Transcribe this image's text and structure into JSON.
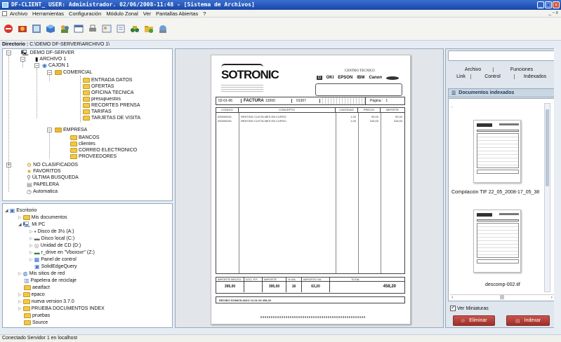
{
  "window": {
    "title": "DF-CLIENT_     USER: Administrador.  02/06/2008-11:48 - [Sistema de Archivos]",
    "controls": [
      "_",
      "□",
      "×"
    ]
  },
  "menubar": {
    "items": [
      "Archivo",
      "Herramientas",
      "Configuración",
      "Módulo Zonal",
      "Ver",
      "Pantallas Abiertas",
      "?"
    ],
    "mdi_controls": "_ ▫ x"
  },
  "toolbar": {
    "icons": [
      "stop-icon",
      "preferences-icon",
      "scan-icon",
      "cube-icon",
      "users-icon",
      "window-icon",
      "print-icon",
      "image-icon",
      "document-icon",
      "binoculars-icon",
      "folder-icon",
      "network-icon"
    ]
  },
  "directory": {
    "label": "Directorio :",
    "path": "C:\\DEMO DF-SERVER\\ARCHIVO 1\\"
  },
  "tree": {
    "server": "DEMO DF-SERVER",
    "archive": "ARCHIVO 1",
    "cajon": "CAJON 1",
    "comercial": "COMERCIAL",
    "comercial_children": [
      "ENTRADA DATOS",
      "OFERTAS",
      "OFICINA TECNICA",
      "presupuestos",
      "RECORTES PRENSA",
      "TARIFAS",
      "TARJETAS DE VISITA"
    ],
    "empresa": "EMPRESA",
    "empresa_children": [
      "BANCOS",
      "clientes",
      "CORREO ELECTRONICO",
      "PROVEEDORES"
    ],
    "no_clasificados": "NO CLASIFICADOS",
    "favoritos": "FAVORITOS",
    "ultima": "ÚLTIMA BUSQUEDA",
    "papelera": "PAPELERA",
    "automatica": "Automatica"
  },
  "explorer": {
    "desktop": "Escritorio",
    "my_docs": "Mis documentos",
    "my_pc": "Mi PC",
    "drives": [
      "Disco de 3½ (A:)",
      "Disco local (C:)",
      "Unidad de CD (D:)",
      "r_drive en \"Vboxsvr\" (Z:)",
      "Panel de control",
      "SolidEdgeQuery"
    ],
    "network": "Mis sitios de red",
    "recycle": "Papelera de reciclaje",
    "folders": [
      "aeatfact",
      "epaco",
      "nueva version 3.7.0",
      "PRUEBA DOCUMENTOS INDEX",
      "pruebas",
      "Source"
    ]
  },
  "invoice": {
    "company": "SOTRONIC",
    "center": "CENTRO TECNICO",
    "brands": [
      "OKI",
      "EPSON",
      "IBM",
      "Canon"
    ],
    "date": "02-01-06",
    "doc_type": "FACTURA",
    "number": "12000",
    "code": "01367",
    "page_label": "Página :",
    "page": "1",
    "headers": [
      "CODIGO",
      "CONCEPTO",
      "CANTIDAD",
      "PRECIO",
      "IMPORTE"
    ],
    "rows": [
      {
        "code": "000000001",
        "concept": "RENTING CUOTA MES EN CURSO",
        "qty": "1,00",
        "price": "90,00",
        "amount": "90,00"
      },
      {
        "code": "000000001",
        "concept": "RENTING CUOTA MES EN CURSO",
        "qty": "1,00",
        "price": "315,00",
        "amount": "315,00"
      }
    ],
    "totals_headers": [
      "IMPORTE BRUTO",
      "DTO. P.P.",
      "IMPORTE",
      "% IVA",
      "IMPORTE IVA",
      "TOTAL"
    ],
    "totals": [
      "395,00",
      "395,00",
      "16",
      "63,20",
      "458,20"
    ],
    "payment": "RECIBO DOMICILIADO   13-01-06   458,20"
  },
  "right": {
    "tabs_top": [
      "Archivo",
      "Funciones"
    ],
    "tabs_bottom": [
      "Link",
      "Control",
      "Indexados"
    ],
    "section_title": "Documentos indexados",
    "thumb1_caption": "Compilación TIF 22_05_2008-17_05_38",
    "thumb2_caption": "descomp-002.tif",
    "miniaturas_label": "Ver Miniaturas",
    "miniaturas_checked": true,
    "btn_delete": "Eliminar",
    "btn_index": "Indexar"
  },
  "status": {
    "text": "Conectado Servidor 1 en localhost"
  },
  "colors": {
    "titlebar": "#1e52b8",
    "panel_bg": "#dfe6ee",
    "button_red": "#b23a36",
    "folder": "#f1c84a"
  }
}
